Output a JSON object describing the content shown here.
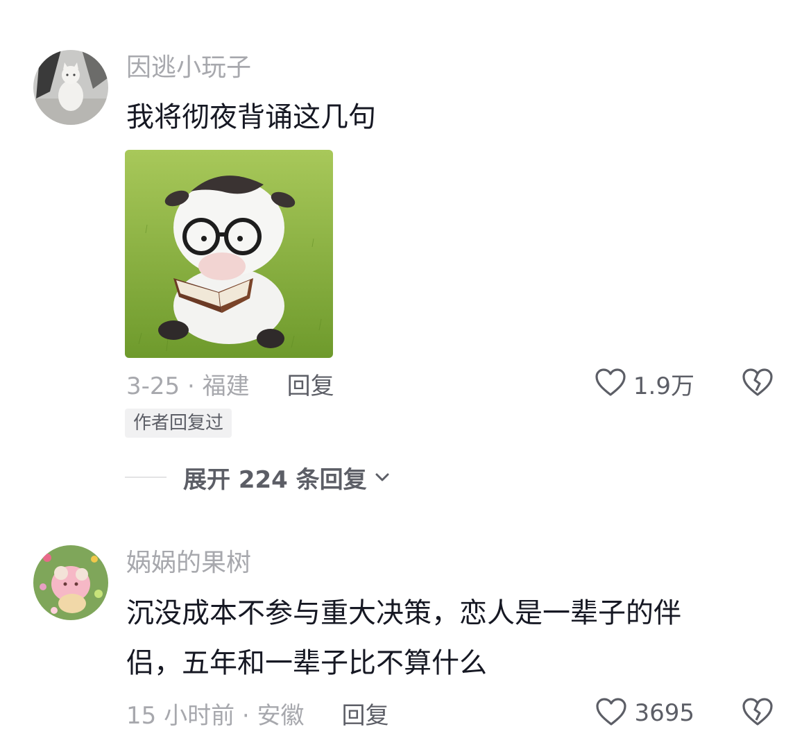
{
  "comments": [
    {
      "username": "因逃小玩子",
      "text": "我将彻夜背诵这几句",
      "date_location": "3-25 · 福建",
      "reply_label": "回复",
      "likes": "1.9万",
      "author_replied_badge": "作者回复过",
      "expand_replies": "展开 224 条回复"
    },
    {
      "username": "娲娲的果树",
      "text_line1": "沉没成本不参与重大决策，恋人是一辈子的伴",
      "text_line2": "侣，五年和一辈子比不算什么",
      "date_location": "15 小时前 · 安徽",
      "reply_label": "回复",
      "likes": "3695"
    }
  ],
  "colors": {
    "primary_text": "#161823",
    "secondary_text": "#a7a8ad",
    "action_text": "#5c5e66",
    "badge_bg": "#f1f1f2"
  },
  "icons": [
    "heart-outline-icon",
    "broken-heart-icon",
    "chevron-down-icon"
  ]
}
